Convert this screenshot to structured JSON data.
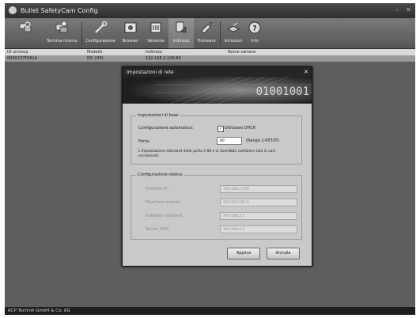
{
  "window": {
    "title": "Bullet SafetyCam Config",
    "minimize": "–",
    "close": "✕"
  },
  "toolbar": [
    {
      "id": "tb-search",
      "label": "",
      "icon": "network-search-icon"
    },
    {
      "id": "tb-terminal",
      "label": "Termina ricerca",
      "icon": "stop-search-icon"
    },
    {
      "id": "tb-config",
      "label": "Configurazione",
      "icon": "configuration-icon"
    },
    {
      "id": "tb-browser",
      "label": "Browser",
      "icon": "browser-icon"
    },
    {
      "id": "tb-version",
      "label": "Versione",
      "icon": "version-icon"
    },
    {
      "id": "tb-address",
      "label": "Indirizzo",
      "icon": "address-icon"
    },
    {
      "id": "tb-firmware",
      "label": "Firmware",
      "icon": "firmware-icon"
    },
    {
      "id": "tb-instructions",
      "label": "Istruzioni",
      "icon": "instructions-icon"
    },
    {
      "id": "tb-info",
      "label": "Info",
      "icon": "info-icon"
    }
  ],
  "table": {
    "columns": [
      "ID univoca",
      "Modello",
      "Indirizzo",
      "Nome camera"
    ],
    "rows": [
      [
        "0050137F9614",
        "IPC (OP)",
        "192.168.2.100:80",
        ""
      ]
    ]
  },
  "dialog": {
    "title": "Impostazioni di rete",
    "close": "✕",
    "banner_text": "01001001",
    "basic": {
      "legend": "Impostazioni di base",
      "auto_label": "Configurazione automatica:",
      "dhcp_checked": true,
      "dhcp_label": "Utilizzare DHCP.",
      "port_label": "Porta:",
      "port_value": "80",
      "port_range": "(Range 1-65535)",
      "note": "L'impostazione standard della porta è 80 e si dovrebbe cambiare solo in casi eccezionali."
    },
    "static": {
      "legend": "Configurazione statica",
      "fields": [
        {
          "label": "Indirizzo IP:",
          "value": "192.168.2.100"
        },
        {
          "label": "Maschera subnet:",
          "value": "255.255.255.0"
        },
        {
          "label": "Gateway standard:",
          "value": "192.168.2.1"
        },
        {
          "label": "Server DNS:",
          "value": "192.168.2.1"
        }
      ]
    },
    "apply_label": "Applica",
    "cancel_label": "Annulla"
  },
  "statusbar": {
    "text": "RCP Technik GmbH & Co. KG"
  }
}
